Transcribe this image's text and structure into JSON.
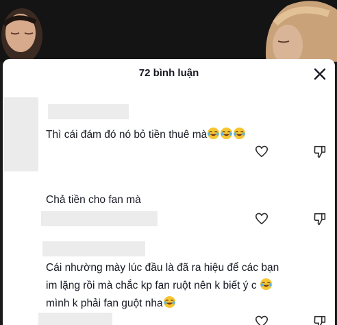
{
  "header": {
    "comment_count_label": "72 bình luận"
  },
  "comments": [
    {
      "text": "Thì cái đám đó nó bỏ tiền thuê mà",
      "emoji": "😂😂😂"
    },
    {
      "text": "Chả tiền cho fan mà"
    },
    {
      "line1": "Cái nhường mày lúc đầu là đã ra hiệu để các bạn",
      "line2": "im lặng rồi mà chắc kp fan ruột nên k biết ý c",
      "line3": "mình k phải fan guột nha",
      "emoji": "😂"
    }
  ],
  "icons": {
    "close": "close-icon",
    "like": "heart-outline-icon",
    "dislike": "thumbs-down-icon",
    "emoji": "face-with-tears-of-joy-emoji"
  },
  "colors": {
    "sheet_bg": "#ffffff",
    "text": "#161823",
    "icon": "#2f2f2f",
    "blur_placeholder": "#ebebeb",
    "emoji_face": "#f7c531"
  }
}
